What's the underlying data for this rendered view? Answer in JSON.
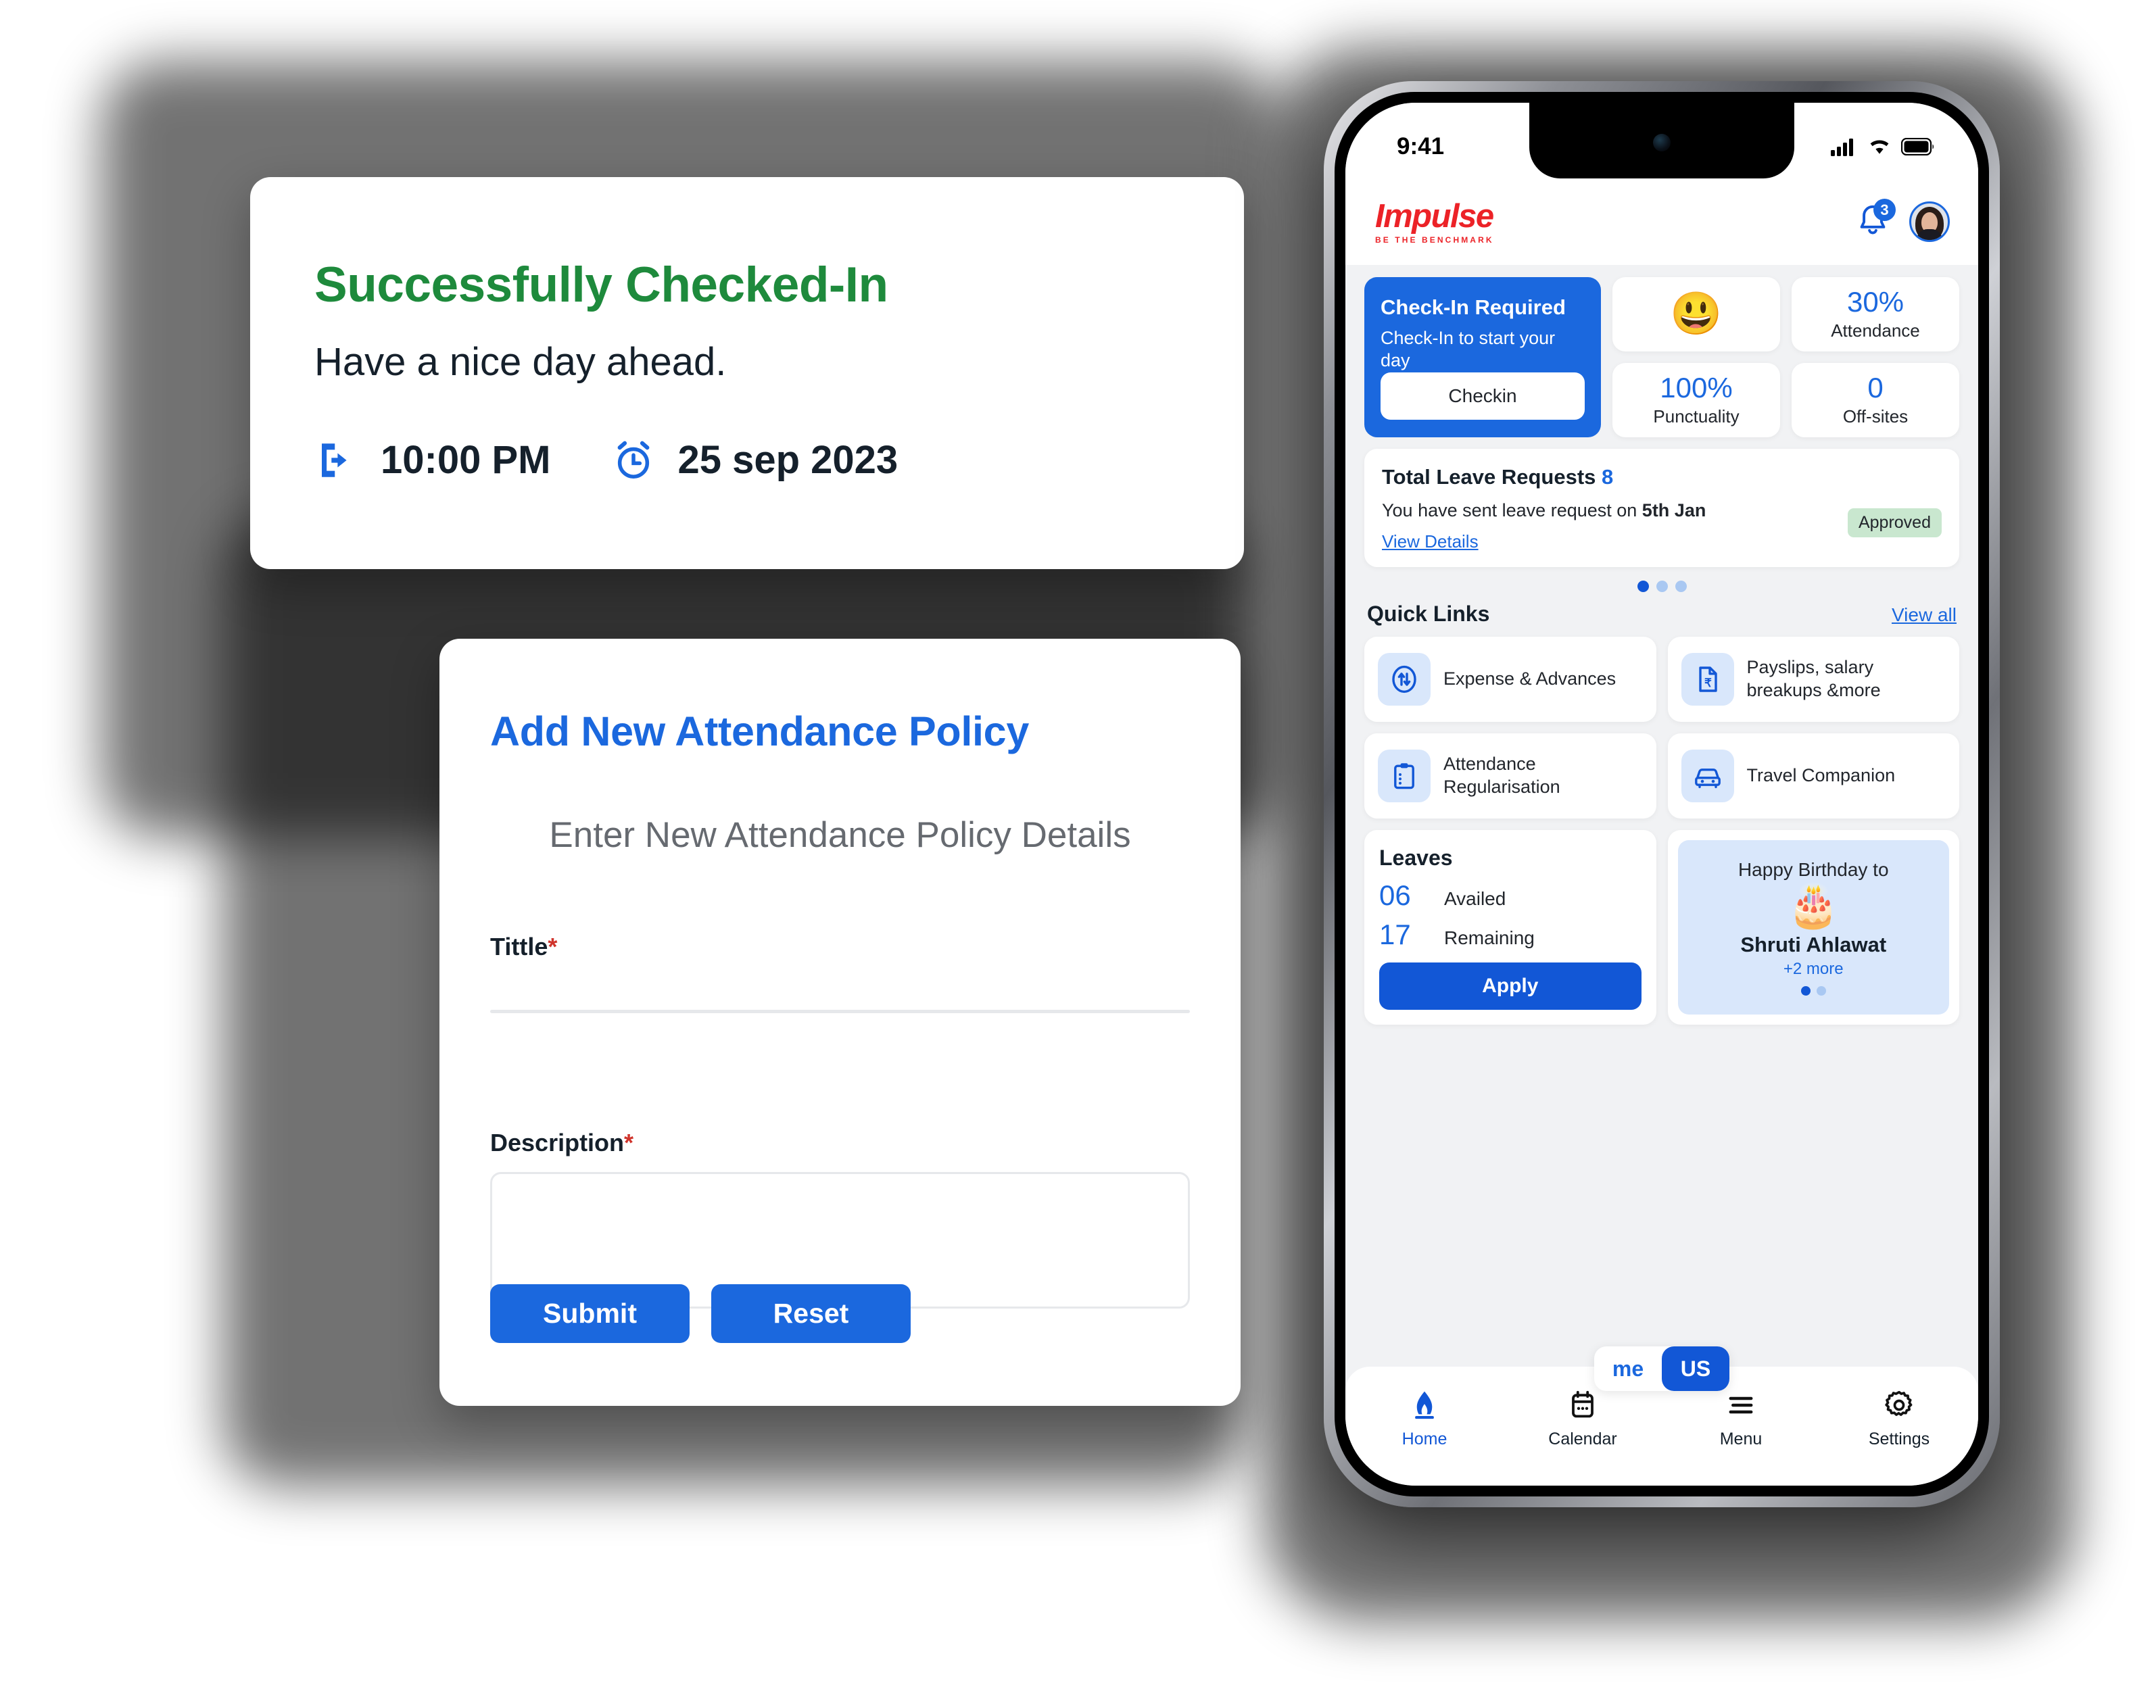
{
  "colors": {
    "blue": "#1B68DE",
    "blue_dark": "#1257D6",
    "green": "#1E8A3C",
    "red": "#EC2227",
    "badge_green_bg": "#C9E7CF",
    "required_red": "#D0342C"
  },
  "checkin_card": {
    "title": "Successfully Checked-In",
    "subtitle": "Have a nice day ahead.",
    "time": "10:00 PM",
    "date": "25 sep 2023",
    "time_icon": "exit-door-arrow-icon",
    "date_icon": "alarm-clock-icon"
  },
  "policy_card": {
    "title": "Add New Attendance Policy",
    "subtitle": "Enter New Attendance Policy Details",
    "title_field": {
      "label": "Tittle",
      "required_mark": "*",
      "value": "",
      "placeholder": ""
    },
    "description_field": {
      "label": "Description",
      "required_mark": "*",
      "value": "",
      "placeholder": ""
    },
    "submit_label": "Submit",
    "reset_label": "Reset"
  },
  "phone": {
    "statusbar": {
      "time": "9:41",
      "icons": [
        "cellular-signal-icon",
        "wifi-icon",
        "battery-icon"
      ]
    },
    "appbar": {
      "logo": "Impulse",
      "logo_tagline": "BE THE BENCHMARK",
      "notification_count": "3",
      "notification_icon": "bell-icon",
      "avatar": "user-avatar"
    },
    "checkin_widget": {
      "heading": "Check-In Required",
      "body": "Check-In to start your day",
      "button_label": "Checkin"
    },
    "stats": [
      {
        "name": "mood",
        "emoji": "😃",
        "value": "",
        "label": ""
      },
      {
        "name": "attendance",
        "value": "30%",
        "label": "Attendance"
      },
      {
        "name": "punctuality",
        "value": "100%",
        "label": "Punctuality"
      },
      {
        "name": "offsites",
        "value": "0",
        "label": "Off-sites"
      }
    ],
    "leave_card": {
      "heading": "Total Leave Requests",
      "count": "8",
      "message_pre": "You have sent leave request on ",
      "message_date": "5th Jan",
      "link": "View Details",
      "badge": "Approved",
      "dots": {
        "total": 3,
        "active": 0
      }
    },
    "quick_links": {
      "title": "Quick Links",
      "view_all": "View all",
      "items": [
        {
          "label": "Expense & Advances",
          "icon": "transfer-arrows-circle-icon"
        },
        {
          "label": "Payslips, salary breakups &more",
          "icon": "document-rupee-icon"
        },
        {
          "label": "Attendance Regularisation",
          "icon": "clipboard-icon"
        },
        {
          "label": "Travel Companion",
          "icon": "car-icon"
        }
      ]
    },
    "leaves": {
      "title": "Leaves",
      "availed_value": "06",
      "availed_label": "Availed",
      "remaining_value": "17",
      "remaining_label": "Remaining",
      "apply_label": "Apply"
    },
    "birthday": {
      "heading": "Happy Birthday to",
      "cake_emoji": "🎂",
      "name": "Shruti Ahlawat",
      "more": "+2 more",
      "dots": {
        "total": 2,
        "active": 0
      }
    },
    "scope_toggle": {
      "left_label": "me",
      "right_label": "US",
      "selected": "US"
    },
    "tabbar": [
      {
        "label": "Home",
        "icon": "home-icon",
        "active": true
      },
      {
        "label": "Calendar",
        "icon": "calendar-icon",
        "active": false
      },
      {
        "label": "Menu",
        "icon": "menu-hamburger-icon",
        "active": false
      },
      {
        "label": "Settings",
        "icon": "gear-icon",
        "active": false
      }
    ]
  }
}
